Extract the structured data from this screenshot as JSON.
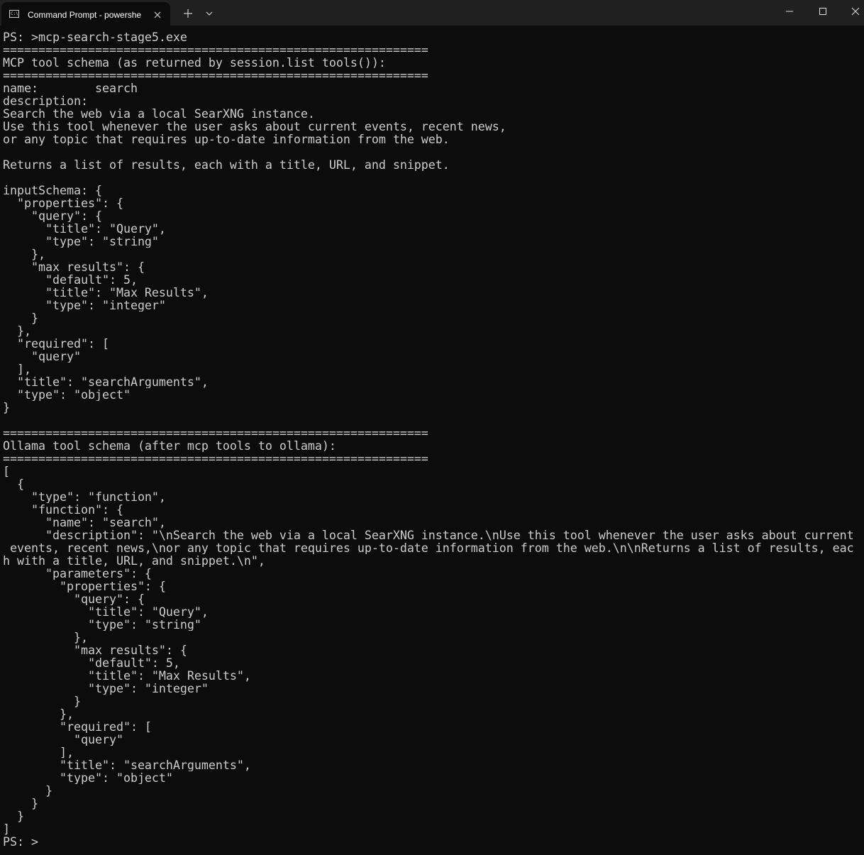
{
  "window": {
    "tab_title": "Command Prompt - powershe",
    "tab_icon": "C:\\",
    "colors": {
      "titlebar": "#202020",
      "background": "#0c0c0c",
      "text": "#cccccc"
    }
  },
  "terminal": {
    "lines": [
      "PS: >mcp-search-stage5.exe",
      "============================================================",
      "MCP tool schema (as returned by session.list_tools()):",
      "============================================================",
      "name:        search",
      "description:",
      "Search the web via a local SearXNG instance.",
      "Use this tool whenever the user asks about current events, recent news,",
      "or any topic that requires up-to-date information from the web.",
      "",
      "Returns a list of results, each with a title, URL, and snippet.",
      "",
      "inputSchema: {",
      "  \"properties\": {",
      "    \"query\": {",
      "      \"title\": \"Query\",",
      "      \"type\": \"string\"",
      "    },",
      "    \"max_results\": {",
      "      \"default\": 5,",
      "      \"title\": \"Max Results\",",
      "      \"type\": \"integer\"",
      "    }",
      "  },",
      "  \"required\": [",
      "    \"query\"",
      "  ],",
      "  \"title\": \"searchArguments\",",
      "  \"type\": \"object\"",
      "}",
      "",
      "============================================================",
      "Ollama tool schema (after mcp_tools_to_ollama):",
      "============================================================",
      "[",
      "  {",
      "    \"type\": \"function\",",
      "    \"function\": {",
      "      \"name\": \"search\",",
      "      \"description\": \"\\nSearch the web via a local SearXNG instance.\\nUse this tool whenever the user asks about current",
      " events, recent news,\\nor any topic that requires up-to-date information from the web.\\n\\nReturns a list of results, eac",
      "h with a title, URL, and snippet.\\n\",",
      "      \"parameters\": {",
      "        \"properties\": {",
      "          \"query\": {",
      "            \"title\": \"Query\",",
      "            \"type\": \"string\"",
      "          },",
      "          \"max_results\": {",
      "            \"default\": 5,",
      "            \"title\": \"Max Results\",",
      "            \"type\": \"integer\"",
      "          }",
      "        },",
      "        \"required\": [",
      "          \"query\"",
      "        ],",
      "        \"title\": \"searchArguments\",",
      "        \"type\": \"object\"",
      "      }",
      "    }",
      "  }",
      "]",
      "PS: >"
    ]
  }
}
